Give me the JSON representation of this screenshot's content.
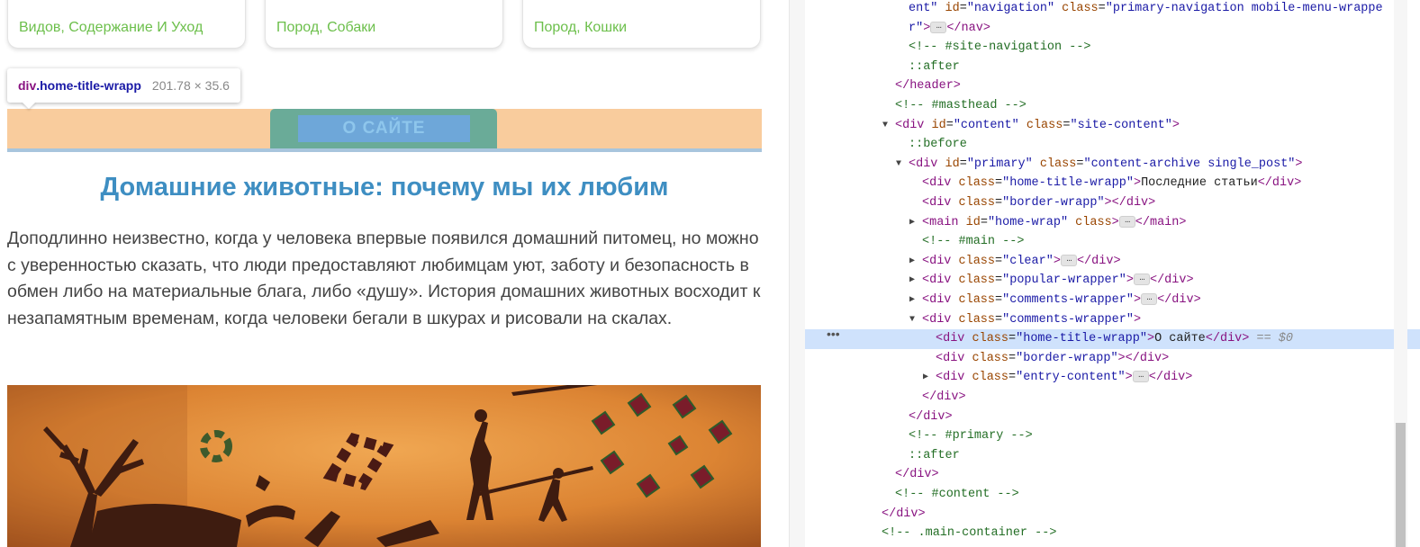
{
  "page": {
    "cards": [
      "Видов, Содержание И Уход",
      "Пород, Собаки",
      "Пород, Кошки"
    ],
    "tooltip": {
      "tag": "div",
      "class": ".home-title-wrapp",
      "dims": "201.78 × 35.6"
    },
    "section_title": "О САЙТЕ",
    "article_title": "Домашние животные: почему мы их любим",
    "article_body": "Доподлинно  неизвестно, когда у человека впервые появился домашний питомец, но можно с уверенностью сказать, что люди предоставляют любимцам уют, заботу и безопасность в обмен либо на материальные блага, либо «душу». История домашних животных восходит к незапамятным временам, когда человеки бегали в шкурах и рисовали на скалах.",
    "colors": {
      "section_band": "#f9cc9d",
      "section_tab": "#6aab98",
      "title_highlight": "#6ea7d9",
      "article_title": "#3e8ec2",
      "category_link": "#6cbf4b"
    },
    "image_name": "cave-painting-image"
  },
  "devtools": {
    "lines": [
      {
        "tokens": [
          [
            "av",
            "ent\""
          ],
          [
            "an",
            " id"
          ],
          [
            "",
            "="
          ],
          [
            "av",
            "\"navigation\""
          ],
          [
            "an",
            " class"
          ],
          [
            "",
            "="
          ],
          [
            "av",
            "\"primary-navigation mobile-menu-wrappe"
          ]
        ]
      },
      {
        "tokens": [
          [
            "av",
            "r\""
          ],
          [
            "t",
            ">"
          ],
          [
            "ell",
            "…"
          ],
          [
            "t",
            "</nav>"
          ]
        ]
      },
      {
        "tokens": [
          [
            "cm",
            "<!-- #site-navigation -->"
          ]
        ]
      },
      {
        "tokens": [
          [
            "ps",
            "::after"
          ]
        ]
      },
      {
        "tokens": [
          [
            "t",
            "</header>"
          ]
        ]
      },
      {
        "tokens": [
          [
            "cm",
            "<!-- #masthead -->"
          ]
        ]
      },
      {
        "tokens": [
          [
            "t",
            "<div"
          ],
          [
            "an",
            " id"
          ],
          [
            "",
            "="
          ],
          [
            "av",
            "\"content\""
          ],
          [
            "an",
            " class"
          ],
          [
            "",
            "="
          ],
          [
            "av",
            "\"site-content\""
          ],
          [
            "t",
            ">"
          ]
        ]
      },
      {
        "tokens": [
          [
            "ps",
            "::before"
          ]
        ]
      },
      {
        "tokens": [
          [
            "t",
            "<div"
          ],
          [
            "an",
            " id"
          ],
          [
            "",
            "="
          ],
          [
            "av",
            "\"primary\""
          ],
          [
            "an",
            " class"
          ],
          [
            "",
            "="
          ],
          [
            "av",
            "\"content-archive single_post\""
          ],
          [
            "t",
            ">"
          ]
        ]
      },
      {
        "tokens": [
          [
            "t",
            "<div"
          ],
          [
            "an",
            " class"
          ],
          [
            "",
            "="
          ],
          [
            "av",
            "\"home-title-wrapp\""
          ],
          [
            "t",
            ">"
          ],
          [
            "",
            "Последние статьи"
          ],
          [
            "t",
            "</div>"
          ]
        ]
      },
      {
        "tokens": [
          [
            "t",
            "<div"
          ],
          [
            "an",
            " class"
          ],
          [
            "",
            "="
          ],
          [
            "av",
            "\"border-wrapp\""
          ],
          [
            "t",
            "></div>"
          ]
        ]
      },
      {
        "tokens": [
          [
            "t",
            "<main"
          ],
          [
            "an",
            " id"
          ],
          [
            "",
            "="
          ],
          [
            "av",
            "\"home-wrap\""
          ],
          [
            "an",
            " class"
          ],
          [
            "t",
            ">"
          ],
          [
            "ell",
            "…"
          ],
          [
            "t",
            "</main>"
          ]
        ]
      },
      {
        "tokens": [
          [
            "cm",
            "<!-- #main -->"
          ]
        ]
      },
      {
        "tokens": [
          [
            "t",
            "<div"
          ],
          [
            "an",
            " class"
          ],
          [
            "",
            "="
          ],
          [
            "av",
            "\"clear\""
          ],
          [
            "t",
            ">"
          ],
          [
            "ell",
            "…"
          ],
          [
            "t",
            "</div>"
          ]
        ]
      },
      {
        "tokens": [
          [
            "t",
            "<div"
          ],
          [
            "an",
            " class"
          ],
          [
            "",
            "="
          ],
          [
            "av",
            "\"popular-wrapper\""
          ],
          [
            "t",
            ">"
          ],
          [
            "ell",
            "…"
          ],
          [
            "t",
            "</div>"
          ]
        ]
      },
      {
        "tokens": [
          [
            "t",
            "<div"
          ],
          [
            "an",
            " class"
          ],
          [
            "",
            "="
          ],
          [
            "av",
            "\"comments-wrapper\""
          ],
          [
            "t",
            ">"
          ],
          [
            "ell",
            "…"
          ],
          [
            "t",
            "</div>"
          ]
        ]
      },
      {
        "tokens": [
          [
            "t",
            "<div"
          ],
          [
            "an",
            " class"
          ],
          [
            "",
            "="
          ],
          [
            "av",
            "\"comments-wrapper\""
          ],
          [
            "t",
            ">"
          ]
        ]
      },
      {
        "tokens": [
          [
            "t",
            "<div"
          ],
          [
            "an",
            " class"
          ],
          [
            "",
            "="
          ],
          [
            "av",
            "\"home-title-wrapp\""
          ],
          [
            "t",
            ">"
          ],
          [
            "",
            "О сайте"
          ],
          [
            "t",
            "</div>"
          ],
          [
            "eq",
            " == $0"
          ]
        ]
      },
      {
        "tokens": [
          [
            "t",
            "<div"
          ],
          [
            "an",
            " class"
          ],
          [
            "",
            "="
          ],
          [
            "av",
            "\"border-wrapp\""
          ],
          [
            "t",
            "></div>"
          ]
        ]
      },
      {
        "tokens": [
          [
            "t",
            "<div"
          ],
          [
            "an",
            " class"
          ],
          [
            "",
            "="
          ],
          [
            "av",
            "\"entry-content\""
          ],
          [
            "t",
            ">"
          ],
          [
            "ell",
            "…"
          ],
          [
            "t",
            "</div>"
          ]
        ]
      },
      {
        "tokens": [
          [
            "t",
            "</div>"
          ]
        ]
      },
      {
        "tokens": [
          [
            "t",
            "</div>"
          ]
        ]
      },
      {
        "tokens": [
          [
            "cm",
            "<!-- #primary -->"
          ]
        ]
      },
      {
        "tokens": [
          [
            "ps",
            "::after"
          ]
        ]
      },
      {
        "tokens": [
          [
            "t",
            "</div>"
          ]
        ]
      },
      {
        "tokens": [
          [
            "cm",
            "<!-- #content -->"
          ]
        ]
      },
      {
        "tokens": [
          [
            "t",
            "</div>"
          ]
        ]
      },
      {
        "tokens": [
          [
            "cm",
            "<!-- .main-container -->"
          ]
        ]
      },
      {
        "tokens": [
          [
            "t",
            "<"
          ]
        ]
      }
    ],
    "selected_marker": "•••"
  }
}
